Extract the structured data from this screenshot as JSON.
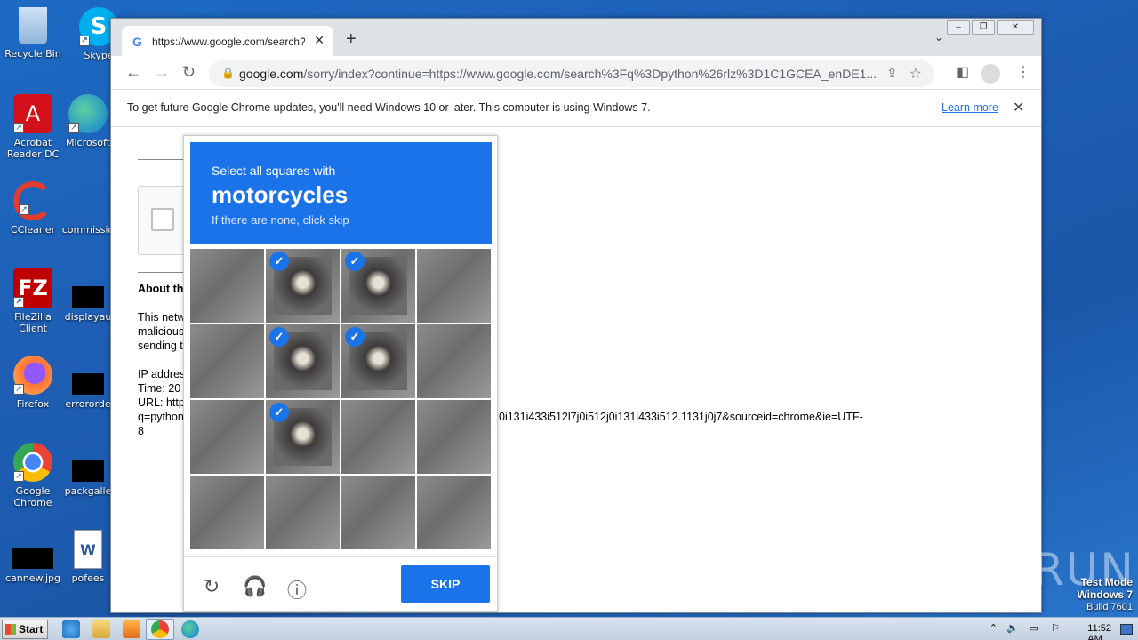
{
  "desktop": {
    "icons": [
      {
        "label": "Recycle Bin"
      },
      {
        "label": "Skype"
      },
      {
        "label": "Acrobat Reader DC"
      },
      {
        "label": "Microsoft"
      },
      {
        "label": "CCleaner"
      },
      {
        "label": "commissio"
      },
      {
        "label": "FileZilla Client"
      },
      {
        "label": "displayau"
      },
      {
        "label": "Firefox"
      },
      {
        "label": "errororde"
      },
      {
        "label": "Google Chrome"
      },
      {
        "label": "packgalle"
      },
      {
        "label": "cannew.jpg"
      },
      {
        "label": "pofees"
      }
    ]
  },
  "browser": {
    "tab": {
      "title": "https://www.google.com/search?q=",
      "favicon": "G"
    },
    "new_tab": "+",
    "window_controls": {
      "minimize": "–",
      "restore": "❐",
      "close": "✕"
    },
    "url": {
      "domain": "google.com",
      "rest": "/sorry/index?continue=https://www.google.com/search%3Fq%3Dpython%26rlz%3D1C1GCEA_enDE1..."
    },
    "infobar": {
      "message": "To get future Google Chrome updates, you'll need Windows 10 or later. This computer is using Windows 7.",
      "link": "Learn more"
    },
    "page": {
      "about": "About th",
      "para": [
        "This netw",
        "malicious",
        "sending t"
      ],
      "ip": "IP addres",
      "time": "Time: 20",
      "url_label": "URL: http",
      "url_line": "q=python",
      "url_tail": "0i131i433i512l7j0i512j0i131i433i512.1131j0j7&sourceid=chrome&ie=UTF-",
      "url_end": "8"
    }
  },
  "captcha": {
    "instruction": "Select all squares with",
    "target": "motorcycles",
    "hint": "If there are none, click skip",
    "selected_tiles": [
      1,
      2,
      5,
      6,
      9
    ],
    "skip_label": "SKIP",
    "footer_icons": [
      "reload-icon",
      "audio-icon",
      "info-icon"
    ]
  },
  "watermark": "ANY RUN",
  "test_mode": {
    "line1": "Test Mode",
    "line2": "Windows 7",
    "line3": "Build 7601"
  },
  "taskbar": {
    "start": "Start",
    "clock": "11:52 AM"
  }
}
